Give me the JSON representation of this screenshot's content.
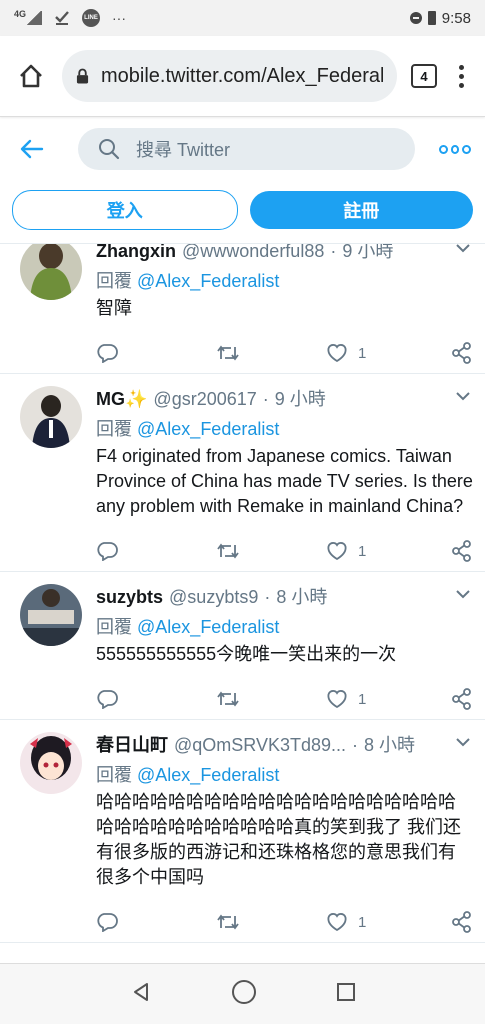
{
  "status_bar": {
    "network": "4G",
    "time": "9:58",
    "icons": [
      "signal-icon",
      "check-icon",
      "line-app-icon",
      "more-notifications-icon",
      "dnd-icon",
      "battery-icon"
    ],
    "line_label": "LINE",
    "more_label": "···"
  },
  "browser": {
    "url": "mobile.twitter.com/Alex_Federalist",
    "tab_count": "4"
  },
  "twitter_header": {
    "search_placeholder": "搜尋 Twitter"
  },
  "auth": {
    "login_label": "登入",
    "signup_label": "註冊"
  },
  "colors": {
    "accent": "#1da1f2",
    "mention": "#1b95e0",
    "muted": "#657786"
  },
  "tweets": [
    {
      "name": "Zhangxin",
      "handle": "@wwwonderful88",
      "dot": "·",
      "time": "9 小時",
      "reply_prefix": "回覆",
      "reply_to": "@Alex_Federalist",
      "text": "智障",
      "likes": "1"
    },
    {
      "name": "MG✨",
      "handle": "@gsr200617",
      "dot": "·",
      "time": "9 小時",
      "reply_prefix": "回覆",
      "reply_to": "@Alex_Federalist",
      "text": "F4 originated from Japanese comics. Taiwan Province of China has made TV series. Is there any problem with Remake in mainland China?",
      "likes": "1"
    },
    {
      "name": "suzybts",
      "handle": "@suzybts9",
      "dot": "·",
      "time": "8 小時",
      "reply_prefix": "回覆",
      "reply_to": "@Alex_Federalist",
      "text": "555555555555今晚唯一笑出来的一次",
      "likes": "1"
    },
    {
      "name": "春日山町",
      "handle": "@qOmSRVK3Td89...",
      "dot": "·",
      "time": "8 小時",
      "reply_prefix": "回覆",
      "reply_to": "@Alex_Federalist",
      "text": "哈哈哈哈哈哈哈哈哈哈哈哈哈哈哈哈哈哈哈哈哈哈哈哈哈哈哈哈哈哈哈真的笑到我了 我们还有很多版的西游记和还珠格格您的意思我们有很多个中国吗",
      "likes": "1"
    }
  ]
}
